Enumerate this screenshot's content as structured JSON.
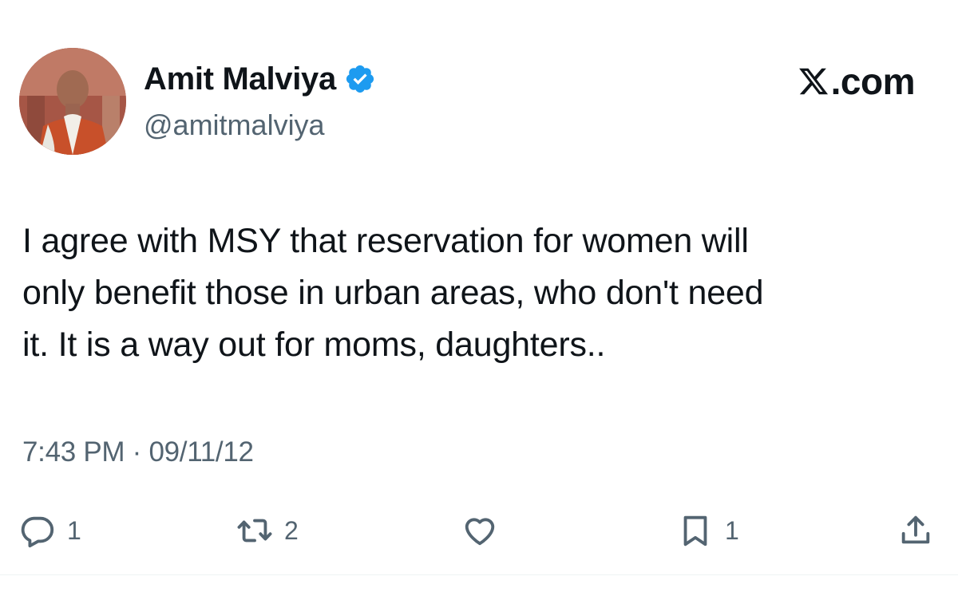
{
  "author": {
    "display_name": "Amit Malviya",
    "handle": "@amitmalviya",
    "verified_icon": "verified-badge-icon",
    "verified_color": "#1d9bf0"
  },
  "brand": {
    "label": ".com",
    "logo_icon": "x-logo-icon"
  },
  "tweet": {
    "text": "I agree with MSY that reservation for women will\nonly benefit those in urban areas, who don't need\nit. It is a way out for moms, daughters..",
    "timestamp": "7:43 PM · 09/11/12"
  },
  "actions": {
    "reply": {
      "icon": "reply-icon",
      "count": "1"
    },
    "retweet": {
      "icon": "retweet-icon",
      "count": "2"
    },
    "like": {
      "icon": "heart-icon",
      "count": ""
    },
    "bookmark": {
      "icon": "bookmark-icon",
      "count": "1"
    },
    "share": {
      "icon": "share-icon"
    }
  },
  "colors": {
    "text_primary": "#0f1419",
    "text_secondary": "#536471",
    "accent": "#1d9bf0",
    "background": "#ffffff"
  }
}
